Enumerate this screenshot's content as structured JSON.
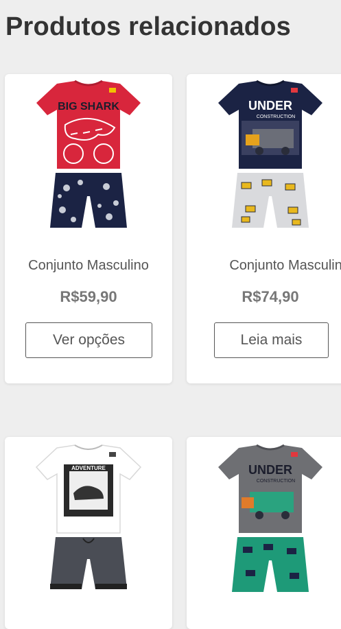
{
  "section": {
    "title": "Produtos relacionados"
  },
  "products": [
    {
      "name": "Conjunto Masculino",
      "price": "R$59,90",
      "button": "Ver opções",
      "image": {
        "icon": "tshirt-shorts-image",
        "shirt_color": "#d8263c",
        "shorts_color": "#1b2344",
        "print_text": "BIG SHARK"
      }
    },
    {
      "name": "Conjunto Masculino",
      "price": "R$74,90",
      "button": "Leia mais",
      "image": {
        "icon": "tshirt-shorts-image",
        "shirt_color": "#1b2344",
        "shorts_color": "#d9dadd",
        "print_text": "UNDER",
        "print_subtext": "CONSTRUCTION"
      }
    },
    {
      "image": {
        "icon": "tshirt-shorts-image",
        "shirt_color": "#ffffff",
        "shorts_color": "#4a4d55",
        "print_text": "ADVENTURE"
      }
    },
    {
      "image": {
        "icon": "tshirt-shorts-image",
        "shirt_color": "#6e6f73",
        "shorts_color": "#1e9a78",
        "print_text": "UNDER",
        "print_subtext": "CONSTRUCTION"
      }
    }
  ]
}
